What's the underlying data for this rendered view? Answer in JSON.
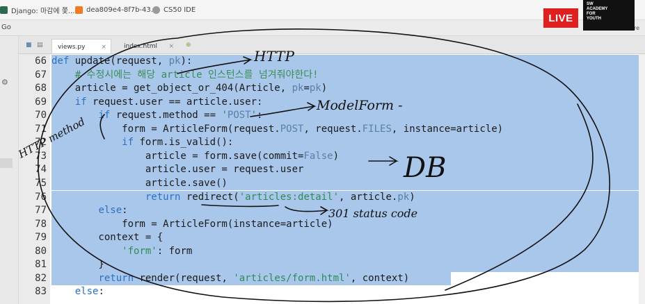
{
  "bookmarks": [
    {
      "label": "Django: 마감에 쫓...",
      "color": "#2d6a4f"
    },
    {
      "label": "dea809e4-8f7b-43...",
      "color": "#f07b22"
    },
    {
      "label": "CS50 IDE",
      "color": "#9a9a9a"
    }
  ],
  "menubar": {
    "go": "Go",
    "share": "Share"
  },
  "live_badge": "LIVE",
  "logo": [
    "SW",
    "ACADEMY",
    "FOR",
    "YOUTH"
  ],
  "tabs": [
    {
      "label": "views.py",
      "close": "×",
      "active": true
    },
    {
      "label": "index.html",
      "close": "×",
      "active": false
    }
  ],
  "editor": {
    "lines": [
      {
        "num": "66",
        "text": "def update(request, pk):"
      },
      {
        "num": "67",
        "text": "    # 수정시에는 해당 article 인스턴스를 넘겨줘야한다!"
      },
      {
        "num": "68",
        "text": "    article = get_object_or_404(Article, pk=pk)"
      },
      {
        "num": "69",
        "text": "    if request.user == article.user:"
      },
      {
        "num": "70",
        "text": "        if request.method == 'POST':"
      },
      {
        "num": "71",
        "text": "            form = ArticleForm(request.POST, request.FILES, instance=article)"
      },
      {
        "num": "72",
        "text": "            if form.is_valid():"
      },
      {
        "num": "73",
        "text": "                article = form.save(commit=False)"
      },
      {
        "num": "74",
        "text": "                article.user = request.user"
      },
      {
        "num": "75",
        "text": "                article.save()"
      },
      {
        "num": "76",
        "text": "                return redirect('articles:detail', article.pk)"
      },
      {
        "num": "77",
        "text": "        else:"
      },
      {
        "num": "78",
        "text": "            form = ArticleForm(instance=article)"
      },
      {
        "num": "79",
        "text": "        context = {"
      },
      {
        "num": "80",
        "text": "            'form': form"
      },
      {
        "num": "81",
        "text": "        }"
      },
      {
        "num": "82",
        "text": "        return render(request, 'articles/form.html', context)"
      },
      {
        "num": "83",
        "text": "    else:"
      }
    ],
    "highlight_color": "#a9c7eb"
  },
  "annotations": [
    "HTTP",
    "ModelForm -",
    "HTTP method",
    "DB",
    "301 status code"
  ]
}
